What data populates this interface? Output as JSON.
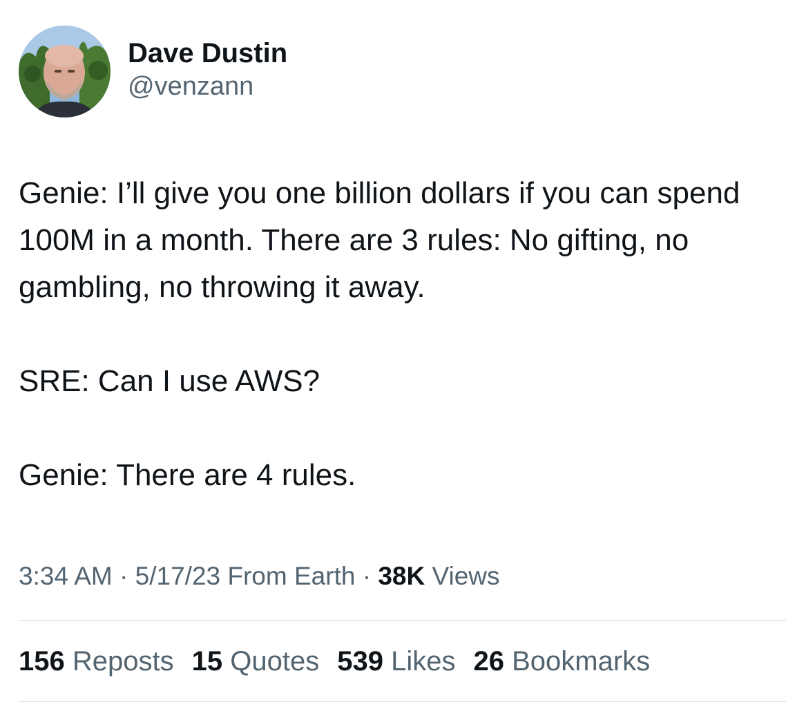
{
  "author": {
    "display_name": "Dave Dustin",
    "handle": "@venzann",
    "avatar": "profile-photo"
  },
  "tweet": {
    "paragraphs": [
      "Genie: I’ll give you one billion dollars if you can spend 100M in a month. There are 3 rules: No gifting, no gambling, no throwing it away.",
      "SRE: Can I use AWS?",
      "Genie: There are 4 rules."
    ]
  },
  "meta": {
    "time": "3:34 AM",
    "sep1": " · ",
    "date": "5/17/23",
    "source": " From Earth",
    "sep2": " · ",
    "views_count": "38K",
    "views_label": " Views"
  },
  "stats": [
    {
      "count": "156",
      "label": "Reposts"
    },
    {
      "count": "15",
      "label": "Quotes"
    },
    {
      "count": "539",
      "label": "Likes"
    },
    {
      "count": "26",
      "label": "Bookmarks"
    }
  ],
  "colors": {
    "primary_text": "#0f1419",
    "secondary_text": "#536471",
    "divider": "#cfd9de",
    "background": "#ffffff"
  }
}
